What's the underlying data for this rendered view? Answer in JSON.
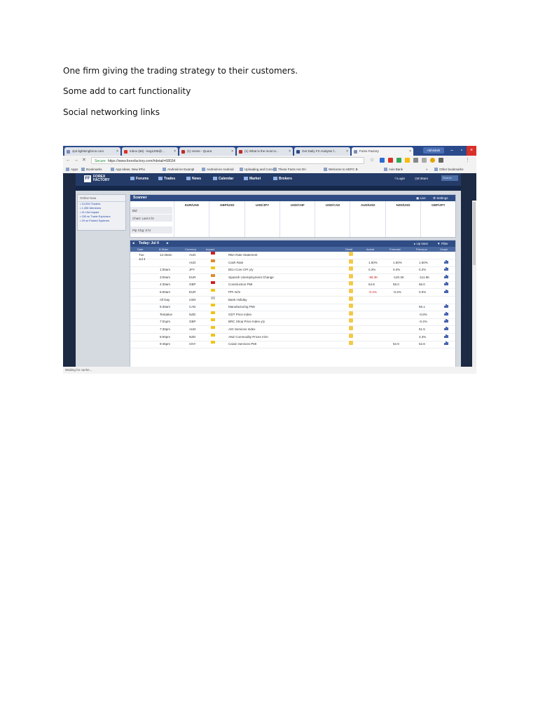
{
  "doc": {
    "lines": [
      "One firm giving the trading strategy to their customers.",
      "Some add to cart functionality",
      "Social networking links"
    ]
  },
  "browser": {
    "tabs": [
      {
        "label": "zp2.lightningforce.com",
        "color": "#7a8fbf"
      },
      {
        "label": "Inbox (66) - keg1205@...",
        "color": "#d93025"
      },
      {
        "label": "(1) Home - Quora",
        "color": "#b92b27"
      },
      {
        "label": "(1) What is the most in...",
        "color": "#b92b27"
      },
      {
        "label": "Get Daily FX Analysis f...",
        "color": "#2a4a8c"
      },
      {
        "label": "Forex Factory",
        "color": "#7a8fbf"
      }
    ],
    "user_chip": "Abhishek",
    "window_buttons": [
      "–",
      "▫",
      "×"
    ],
    "nav_buttons": [
      "←",
      "→",
      "✕"
    ],
    "url_secure": "Secure",
    "url": "https://www.forexfactory.com/#detail=68034",
    "bookmarks": [
      "Apps",
      "Bookmarks",
      "App Ideas, New iPho",
      "Android-en Exampl",
      "Android-en Android",
      "Uploading and Conv",
      "These Facts Are Dri",
      "Welcome to HDFC B",
      "Axis Bank",
      "»",
      "Other bookmarks"
    ],
    "status": "Waiting for cache..."
  },
  "site": {
    "logo_top": "FOREX",
    "logo_bottom": "FACTORY",
    "nav": [
      "Forums",
      "Trades",
      "News",
      "Calendar",
      "Market",
      "Brokers"
    ],
    "login": "Login",
    "time": "8:36am",
    "search_placeholder": "Search",
    "online": {
      "title": "Online Now",
      "items": [
        "10,534 Traders",
        "1,265 Members",
        "41 Hot Impact",
        "153 w/ Trade Explorers",
        "29 w/ Posted Systems"
      ]
    },
    "scanner": {
      "title": "Scanner",
      "live": "Live",
      "settings": "Settings",
      "pairs": [
        "EUR/USD",
        "GBP/USD",
        "USD/JPY",
        "USD/CHF",
        "USD/CAD",
        "AUD/USD",
        "NZD/USD",
        "GBP/JPY"
      ],
      "labels": [
        "Bid",
        "Chart: Last 6 hr",
        "Pip Chg: 6 hr"
      ]
    },
    "calendar": {
      "title": "Today: Jul 4",
      "up_next": "Up Next",
      "filter": "Filter",
      "columns": [
        "Date",
        "8:36am",
        "Currency",
        "Impact",
        "Detail",
        "Actual",
        "Forecast",
        "Previous",
        "Graph"
      ],
      "date_day": "Tue",
      "date_md": "Jul 4",
      "rows": [
        {
          "time": "12:30am",
          "cur": "AUD",
          "impact": "#cc2222",
          "event": "RBA Rate Statement",
          "actual": "",
          "forecast": "",
          "previous": "",
          "graph": false
        },
        {
          "time": "",
          "cur": "AUD",
          "impact": "#e08a2c",
          "event": "Cash Rate",
          "actual": "1.50%",
          "forecast": "1.50%",
          "previous": "1.50%",
          "graph": true
        },
        {
          "time": "1:00am",
          "cur": "JPY",
          "impact": "#f0c419",
          "event": "BOJ Core CPI y/y",
          "actual": "0.3%",
          "forecast": "0.3%",
          "previous": "0.2%",
          "graph": true
        },
        {
          "time": "3:00am",
          "cur": "EUR",
          "impact": "#e08a2c",
          "event": "Spanish Unemployment Change",
          "actual": "-98.3K",
          "forecast": "-120.3K",
          "previous": "-111.9K",
          "graph": true,
          "neg": true
        },
        {
          "time": "4:30am",
          "cur": "GBP",
          "impact": "#cc2222",
          "event": "Construction PMI",
          "actual": "54.8",
          "forecast": "55.0",
          "previous": "56.0",
          "graph": true
        },
        {
          "time": "5:00am",
          "cur": "EUR",
          "impact": "#f0c419",
          "event": "PPI m/m",
          "actual": "-0.4%",
          "forecast": "-0.2%",
          "previous": "0.0%",
          "graph": true,
          "neg": true
        },
        {
          "time": "All Day",
          "cur": "USD",
          "impact": "#c8c8c8",
          "event": "Bank Holiday",
          "actual": "",
          "forecast": "",
          "previous": "",
          "graph": false
        },
        {
          "time": "9:30am",
          "cur": "CAD",
          "impact": "#f0c419",
          "event": "Manufacturing PMI",
          "actual": "",
          "forecast": "",
          "previous": "55.1",
          "graph": true
        },
        {
          "time": "Tentative",
          "cur": "NZD",
          "impact": "#f0c419",
          "event": "GDT Price Index",
          "actual": "",
          "forecast": "",
          "previous": "-0.8%",
          "graph": true
        },
        {
          "time": "7:01pm",
          "cur": "GBP",
          "impact": "#f0c419",
          "event": "BRC Shop Price Index y/y",
          "actual": "",
          "forecast": "",
          "previous": "-0.4%",
          "graph": true
        },
        {
          "time": "7:30pm",
          "cur": "AUD",
          "impact": "#f0c419",
          "event": "AIG Services Index",
          "actual": "",
          "forecast": "",
          "previous": "51.5",
          "graph": true
        },
        {
          "time": "9:00pm",
          "cur": "NZD",
          "impact": "#f0c419",
          "event": "ANZ Commodity Prices m/m",
          "actual": "",
          "forecast": "",
          "previous": "3.3%",
          "graph": true
        },
        {
          "time": "9:45pm",
          "cur": "CNY",
          "impact": "#f0c419",
          "event": "Caixin Services PMI",
          "actual": "",
          "forecast": "52.9",
          "previous": "52.8",
          "graph": true
        }
      ]
    }
  }
}
